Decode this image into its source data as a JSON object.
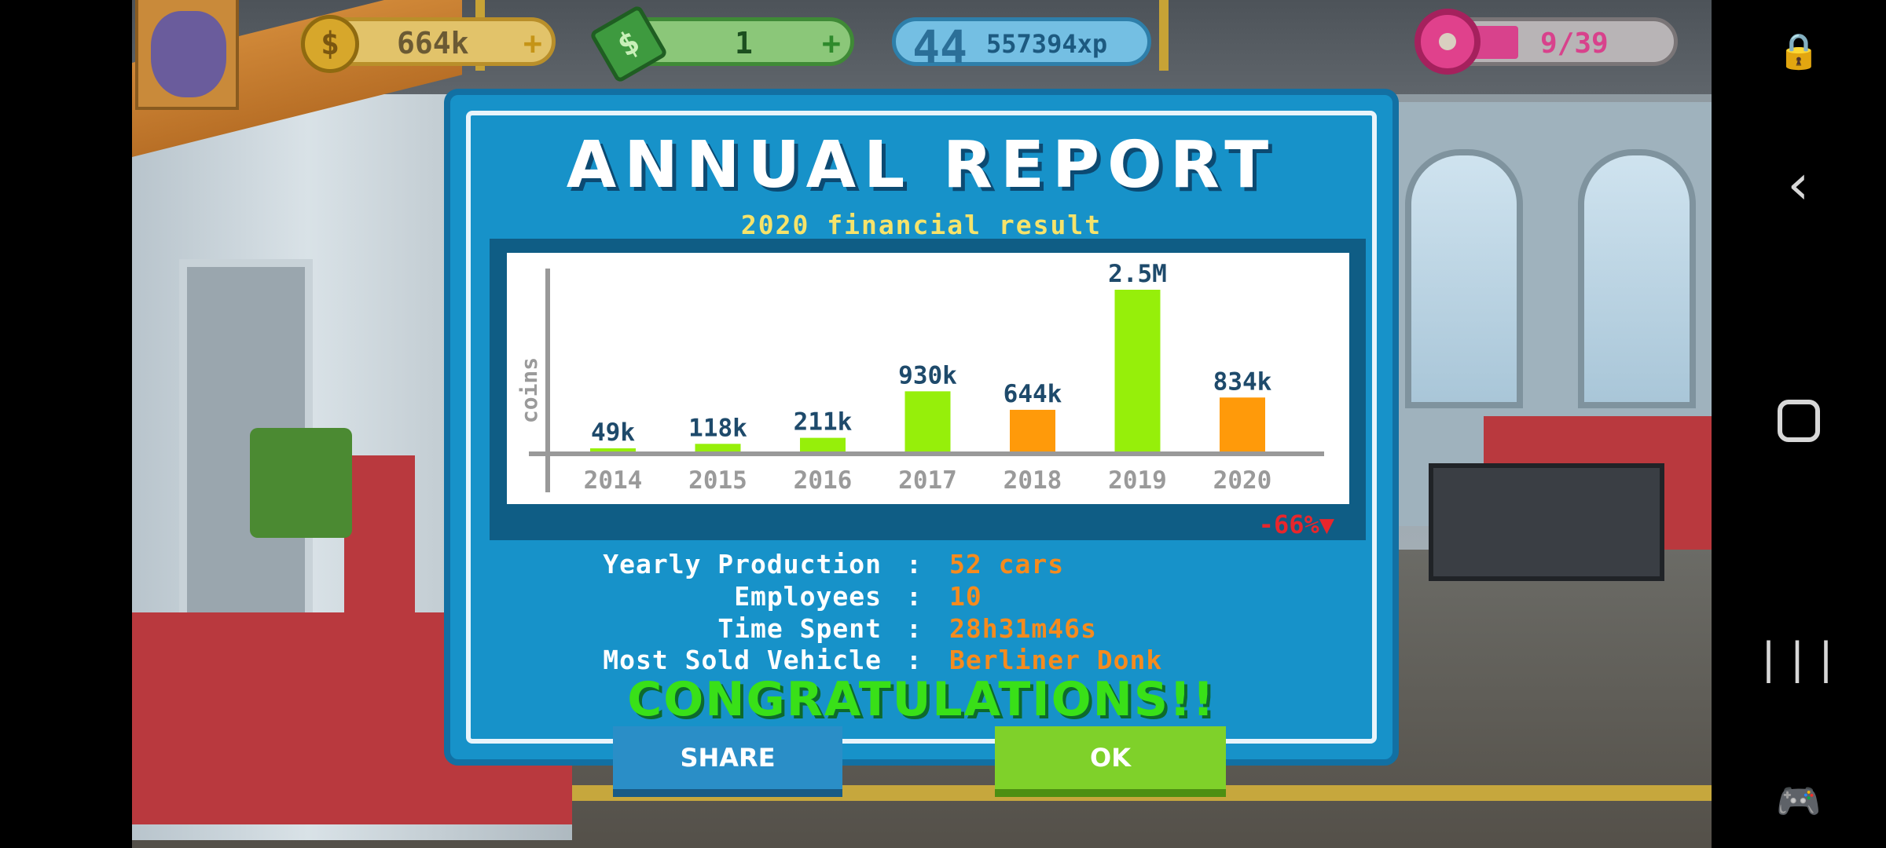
{
  "hud": {
    "coins": "664k",
    "cash": "1",
    "level": "44",
    "xp": "557394xp",
    "donuts": "9/39",
    "donut_progress": 0.23
  },
  "dialog": {
    "title": "ANNUAL REPORT",
    "subtitle": "2020 financial result",
    "delta": "-66%▼",
    "stats": [
      {
        "label": "Yearly Production",
        "value": "52 cars"
      },
      {
        "label": "Employees",
        "value": "10"
      },
      {
        "label": "Time Spent",
        "value": "28h31m46s"
      },
      {
        "label": "Most Sold Vehicle",
        "value": "Berliner Donk"
      }
    ],
    "congrats": "CONGRATULATIONS!!",
    "share_label": "SHARE",
    "ok_label": "OK"
  },
  "colors": {
    "increase_bar": "#96ef0a",
    "decrease_bar": "#ff9a0a",
    "axis": "#999999",
    "value_label": "#1e4a6b",
    "tick_label": "#9a9a9a"
  },
  "chart_data": {
    "type": "bar",
    "ylabel": "coins",
    "categories": [
      "2014",
      "2015",
      "2016",
      "2017",
      "2018",
      "2019",
      "2020"
    ],
    "values": [
      49000,
      118000,
      211000,
      930000,
      644000,
      2500000,
      834000
    ],
    "value_labels": [
      "49k",
      "118k",
      "211k",
      "930k",
      "644k",
      "2.5M",
      "834k"
    ],
    "trend": [
      "up",
      "up",
      "up",
      "up",
      "down",
      "up",
      "down"
    ],
    "ylim": [
      0,
      2500000
    ],
    "grid": false
  },
  "navbar": {
    "lock_icon": "🔒",
    "back_icon": "‹",
    "recent_icon": "|||",
    "game_icon": "🎮"
  }
}
